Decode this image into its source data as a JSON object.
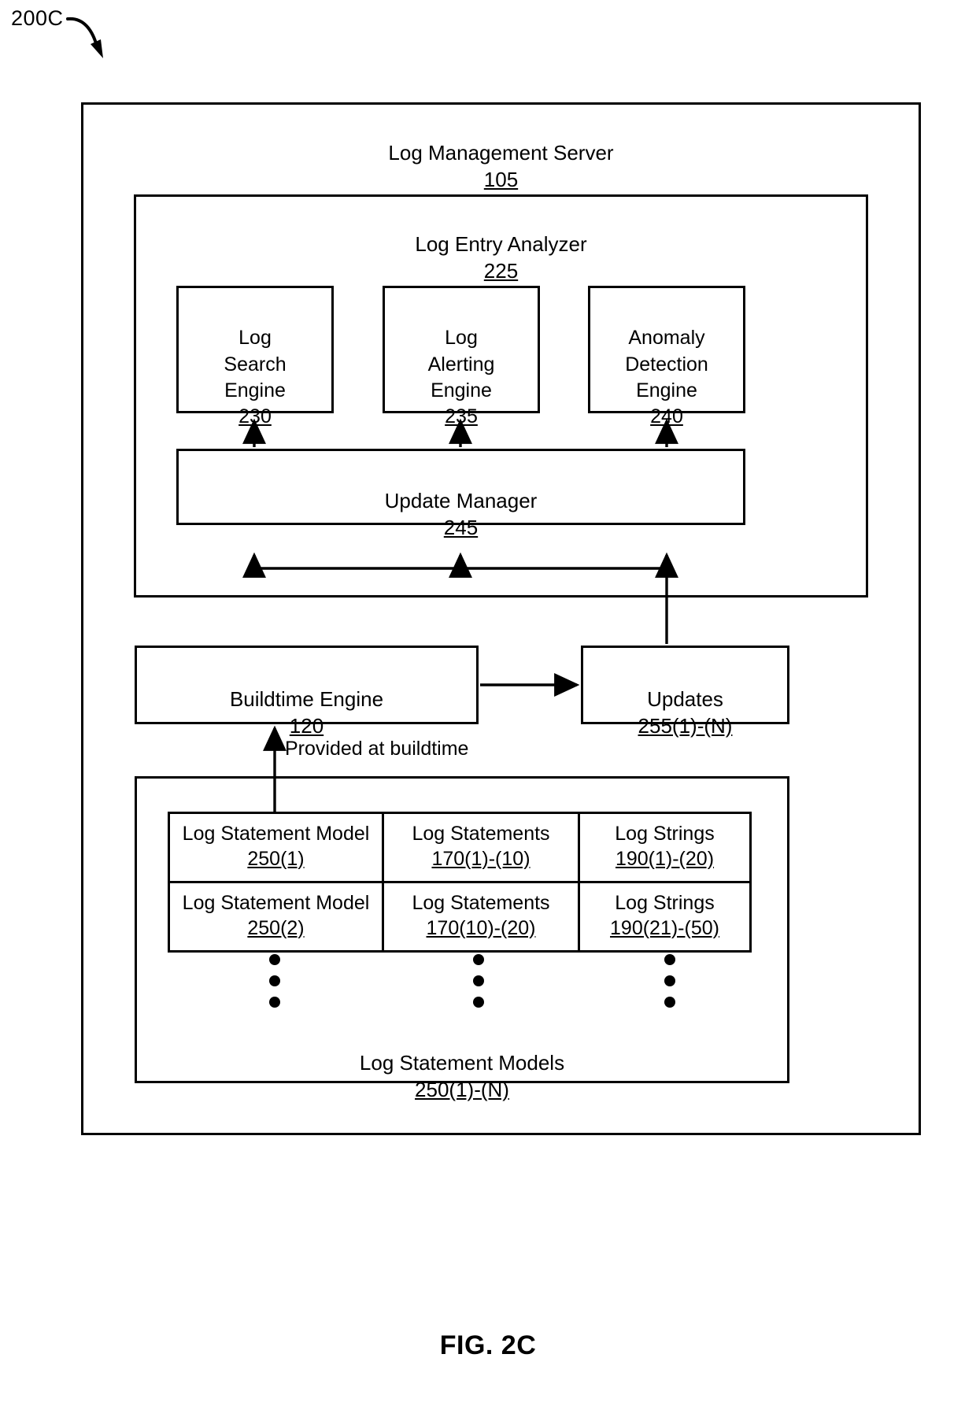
{
  "figure": {
    "ref_label": "200C",
    "caption": "FIG. 2C"
  },
  "outer": {
    "title": "Log Management Server",
    "ref": "105"
  },
  "analyzer": {
    "title": "Log Entry Analyzer",
    "ref": "225",
    "engines": [
      {
        "name": "Log\nSearch\nEngine",
        "ref": "230"
      },
      {
        "name": "Log\nAlerting\nEngine",
        "ref": "235"
      },
      {
        "name": "Anomaly\nDetection\nEngine",
        "ref": "240"
      }
    ],
    "update_manager": {
      "title": "Update Manager",
      "ref": "245"
    }
  },
  "buildtime": {
    "title": "Buildtime Engine",
    "ref": "120"
  },
  "updates": {
    "title": "Updates",
    "ref": "255(1)-(N)"
  },
  "buildtime_note": "Provided at buildtime",
  "models": {
    "title": "Log Statement Models",
    "ref": "250(1)-(N)",
    "rows": [
      [
        {
          "title": "Log Statement Model",
          "ref": "250(1)"
        },
        {
          "title": "Log Statements",
          "ref": "170(1)-(10)"
        },
        {
          "title": "Log Strings",
          "ref": "190(1)-(20)"
        }
      ],
      [
        {
          "title": "Log Statement Model",
          "ref": "250(2)"
        },
        {
          "title": "Log Statements",
          "ref": "170(10)-(20)"
        },
        {
          "title": "Log Strings",
          "ref": "190(21)-(50)"
        }
      ]
    ],
    "ellipsis_dot_count": 3
  },
  "colors": {
    "stroke": "#000000",
    "background": "#ffffff"
  }
}
